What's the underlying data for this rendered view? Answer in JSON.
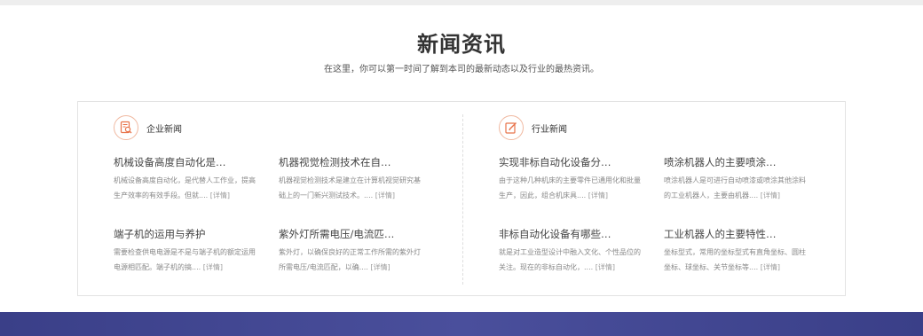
{
  "section": {
    "title": "新闻资讯",
    "subtitle": "在这里，你可以第一时间了解到本司的最新动态以及行业的最热资讯。"
  },
  "columns": [
    {
      "title": "企业新闻",
      "icon": "search-document-icon",
      "items": [
        {
          "title": "机械设备高度自动化是…",
          "desc": "机械设备高度自动化，是代替人工作业，提高生产效率的有效手段。但就....",
          "more": "[详情]"
        },
        {
          "title": "机器视觉检测技术在自…",
          "desc": "机器视觉检测技术是建立在计算机视觉研究基础上的一门新兴测试技术。....",
          "more": "[详情]"
        },
        {
          "title": "端子机的运用与养护",
          "desc": "需要检查供电电源是不是与端子机的额定运用电源相匹配。端子机的搞....",
          "more": "[详情]"
        },
        {
          "title": "紫外灯所需电压/电流匹…",
          "desc": "紫外灯，以确保良好的正常工作所需的紫外灯所需电压/电流匹配，以确....",
          "more": "[详情]"
        }
      ]
    },
    {
      "title": "行业新闻",
      "icon": "edit-icon",
      "items": [
        {
          "title": "实现非标自动化设备分…",
          "desc": "由于这种几种机床的主要零件已通用化和批量生产，因此，组合机床具....",
          "more": "[详情]"
        },
        {
          "title": "喷涂机器人的主要喷涂…",
          "desc": "喷涂机器人是可进行自动喷漆或喷涂其他涂料的工业机器人，主要由机器....",
          "more": "[详情]"
        },
        {
          "title": "非标自动化设备有哪些…",
          "desc": "就是对工业造型设计中融入文化、个性品位的关注。现在的非标自动化，....",
          "more": "[详情]"
        },
        {
          "title": "工业机器人的主要特性…",
          "desc": "坐标型式，常用的坐标型式有直角坐标、圆柱坐标、球坐标、关节坐标等....",
          "more": "[详情]"
        }
      ]
    }
  ],
  "colors": {
    "accent": "#e8734a",
    "band": "#3f4490"
  }
}
